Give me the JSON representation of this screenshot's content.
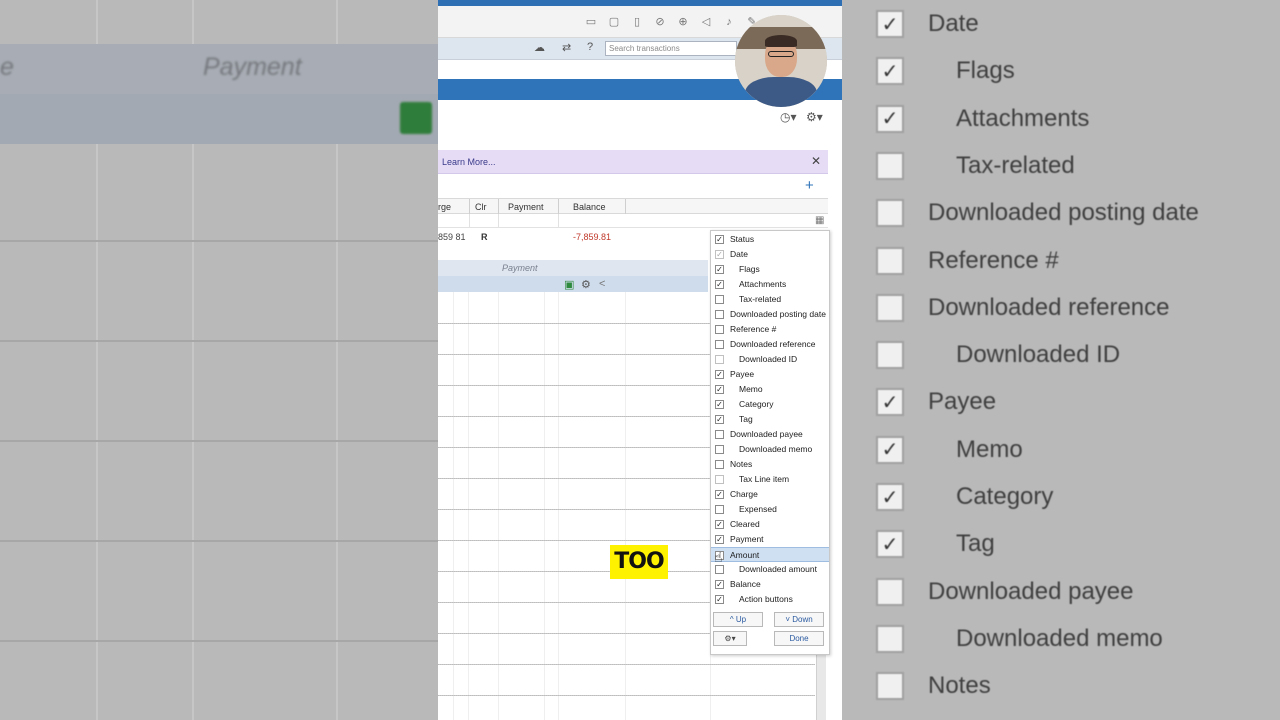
{
  "app": {
    "search_placeholder": "Search transactions",
    "banner_text": "Learn More...",
    "banner_close": "✕",
    "add_button": "+",
    "overlay_caption": "TOO"
  },
  "icons": {
    "cloud": "☁",
    "sync": "⇄",
    "help": "?",
    "clock": "◷▾",
    "gear_menu": "⚙▾",
    "grid": "▦",
    "save": "▣",
    "gear": "⚙",
    "share": "<",
    "window_icons": [
      "▭",
      "▢",
      "▯",
      "⊘",
      "⊕",
      "◁",
      "♪",
      "✎",
      "⚙"
    ]
  },
  "register": {
    "columns": [
      "rge",
      "Clr",
      "Payment",
      "Balance"
    ],
    "row": {
      "charge": "859 81",
      "cleared": "R",
      "balance": "-7,859.81"
    },
    "edit_row": {
      "payment_placeholder": "Payment"
    }
  },
  "column_chooser": {
    "items": [
      {
        "label": "Status",
        "checked": true,
        "indent": false,
        "disabled": false
      },
      {
        "label": "Date",
        "checked": true,
        "indent": false,
        "disabled": true
      },
      {
        "label": "Flags",
        "checked": true,
        "indent": true,
        "disabled": false
      },
      {
        "label": "Attachments",
        "checked": true,
        "indent": true,
        "disabled": false
      },
      {
        "label": "Tax-related",
        "checked": false,
        "indent": true,
        "disabled": false
      },
      {
        "label": "Downloaded posting date",
        "checked": false,
        "indent": false,
        "disabled": false
      },
      {
        "label": "Reference #",
        "checked": false,
        "indent": false,
        "disabled": false
      },
      {
        "label": "Downloaded reference",
        "checked": false,
        "indent": false,
        "disabled": false
      },
      {
        "label": "Downloaded ID",
        "checked": false,
        "indent": true,
        "disabled": true
      },
      {
        "label": "Payee",
        "checked": true,
        "indent": false,
        "disabled": false
      },
      {
        "label": "Memo",
        "checked": true,
        "indent": true,
        "disabled": false
      },
      {
        "label": "Category",
        "checked": true,
        "indent": true,
        "disabled": false
      },
      {
        "label": "Tag",
        "checked": true,
        "indent": true,
        "disabled": false
      },
      {
        "label": "Downloaded payee",
        "checked": false,
        "indent": false,
        "disabled": false
      },
      {
        "label": "Downloaded memo",
        "checked": false,
        "indent": true,
        "disabled": false
      },
      {
        "label": "Notes",
        "checked": false,
        "indent": false,
        "disabled": false
      },
      {
        "label": "Tax Line item",
        "checked": false,
        "indent": true,
        "disabled": true
      },
      {
        "label": "Charge",
        "checked": true,
        "indent": false,
        "disabled": false
      },
      {
        "label": "Expensed",
        "checked": false,
        "indent": true,
        "disabled": false
      },
      {
        "label": "Cleared",
        "checked": true,
        "indent": false,
        "disabled": false
      },
      {
        "label": "Payment",
        "checked": true,
        "indent": false,
        "disabled": false
      },
      {
        "label": "Amount",
        "checked": false,
        "indent": false,
        "disabled": false,
        "highlighted": true
      },
      {
        "label": "Downloaded amount",
        "checked": false,
        "indent": true,
        "disabled": false
      },
      {
        "label": "Balance",
        "checked": true,
        "indent": false,
        "disabled": false
      },
      {
        "label": "Action buttons",
        "checked": true,
        "indent": true,
        "disabled": false
      }
    ],
    "up_label": "Up",
    "down_label": "Down",
    "done_label": "Done",
    "up_arrow": "^",
    "down_arrow": "˅"
  },
  "background_left": {
    "header_text": "Payment",
    "header_text_left": "e"
  },
  "background_right": {
    "items": [
      {
        "label": "Date",
        "checked": true,
        "indent": false
      },
      {
        "label": "Flags",
        "checked": true,
        "indent": true
      },
      {
        "label": "Attachments",
        "checked": true,
        "indent": true
      },
      {
        "label": "Tax-related",
        "checked": false,
        "indent": true
      },
      {
        "label": "Downloaded posting date",
        "checked": false,
        "indent": false
      },
      {
        "label": "Reference #",
        "checked": false,
        "indent": false
      },
      {
        "label": "Downloaded reference",
        "checked": false,
        "indent": false
      },
      {
        "label": "Downloaded ID",
        "checked": false,
        "indent": true
      },
      {
        "label": "Payee",
        "checked": true,
        "indent": false
      },
      {
        "label": "Memo",
        "checked": true,
        "indent": true
      },
      {
        "label": "Category",
        "checked": true,
        "indent": true
      },
      {
        "label": "Tag",
        "checked": true,
        "indent": true
      },
      {
        "label": "Downloaded payee",
        "checked": false,
        "indent": false
      },
      {
        "label": "Downloaded memo",
        "checked": false,
        "indent": true
      },
      {
        "label": "Notes",
        "checked": false,
        "indent": false
      }
    ]
  },
  "colors": {
    "accent_blue": "#2f73b8",
    "negative_red": "#c0392b",
    "save_green": "#2e8b3d",
    "highlight": "#cfe0f3"
  }
}
